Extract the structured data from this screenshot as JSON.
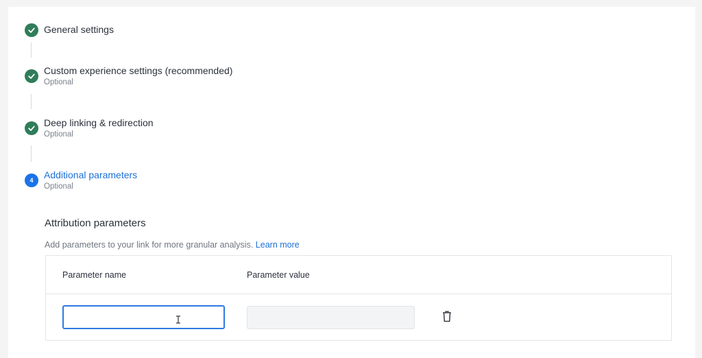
{
  "steps": [
    {
      "title": "General settings",
      "subtitle": "",
      "state": "done"
    },
    {
      "title": "Custom experience settings (recommended)",
      "subtitle": "Optional",
      "state": "done"
    },
    {
      "title": "Deep linking & redirection",
      "subtitle": "Optional",
      "state": "done"
    },
    {
      "title": "Additional parameters",
      "subtitle": "Optional",
      "state": "active",
      "number": "4"
    }
  ],
  "attribution": {
    "title": "Attribution parameters",
    "description": "Add parameters to your link for more granular analysis.",
    "learn_more": "Learn more",
    "columns": {
      "name": "Parameter name",
      "value": "Parameter value"
    },
    "row": {
      "name_value": "",
      "value_value": ""
    }
  },
  "colors": {
    "done": "#2f7d5a",
    "active": "#1a73e8",
    "link": "#1b6fd8"
  },
  "icons": {
    "done": "check-icon",
    "delete": "trash-icon"
  }
}
